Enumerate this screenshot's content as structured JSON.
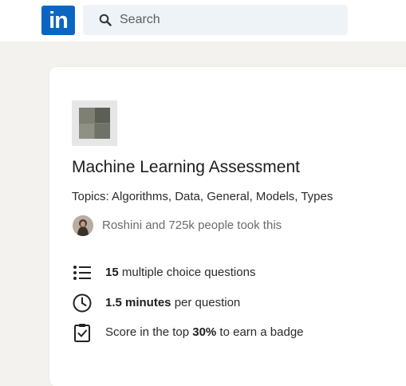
{
  "header": {
    "logo_text": "in",
    "search_placeholder": "Search"
  },
  "assessment": {
    "title": "Machine Learning Assessment",
    "topics": "Topics: Algorithms, Data, General, Models, Types",
    "social_proof": "Roshini and 725k people took this",
    "features": [
      {
        "bold": "15",
        "text": " multiple choice questions",
        "icon": "list-icon"
      },
      {
        "bold": "1.5 minutes",
        "text": " per question",
        "icon": "clock-icon"
      },
      {
        "pre": "Score in the top ",
        "bold": "30%",
        "text": " to earn a badge",
        "icon": "clipboard-check-icon"
      }
    ]
  },
  "colors": {
    "brand": "#0a66c2",
    "background": "#f4f2ee",
    "search_bg": "#eef3f8"
  }
}
